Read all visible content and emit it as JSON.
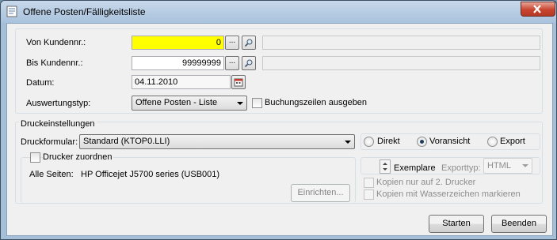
{
  "window": {
    "title": "Offene Posten/Fälligkeitsliste"
  },
  "form": {
    "from_customer": {
      "label": "Von Kundennr.:",
      "value": "0",
      "lookup_label": "..."
    },
    "to_customer": {
      "label": "Bis Kundennr.:",
      "value": "99999999",
      "lookup_label": "..."
    },
    "date": {
      "label": "Datum:",
      "value": "04.11.2010"
    },
    "evaluation_type": {
      "label": "Auswertungstyp:",
      "value": "Offene Posten - Liste"
    },
    "booking_lines": {
      "label": "Buchungszeilen ausgeben",
      "checked": false
    }
  },
  "print": {
    "group_title": "Druckeinstellungen",
    "form_label": "Druckformular:",
    "form_value": "Standard (KTOP0.LLI)",
    "output_options": [
      {
        "label": "Direkt",
        "checked": false
      },
      {
        "label": "Voransicht",
        "checked": true
      },
      {
        "label": "Export",
        "checked": false
      }
    ],
    "assign_printer_label": "Drucker zuordnen",
    "all_pages_label": "Alle Seiten:",
    "printer_name": "HP Officejet J5700 series (USB001)",
    "setup_button": "Einrichten...",
    "copies_label": "Exemplare",
    "export_type_label": "Exporttyp:",
    "export_type_value": "HTML",
    "copies_second_printer": "Kopien nur auf 2. Drucker",
    "copies_watermark": "Kopien mit Wasserzeichen markieren"
  },
  "buttons": {
    "start": "Starten",
    "quit": "Beenden"
  }
}
